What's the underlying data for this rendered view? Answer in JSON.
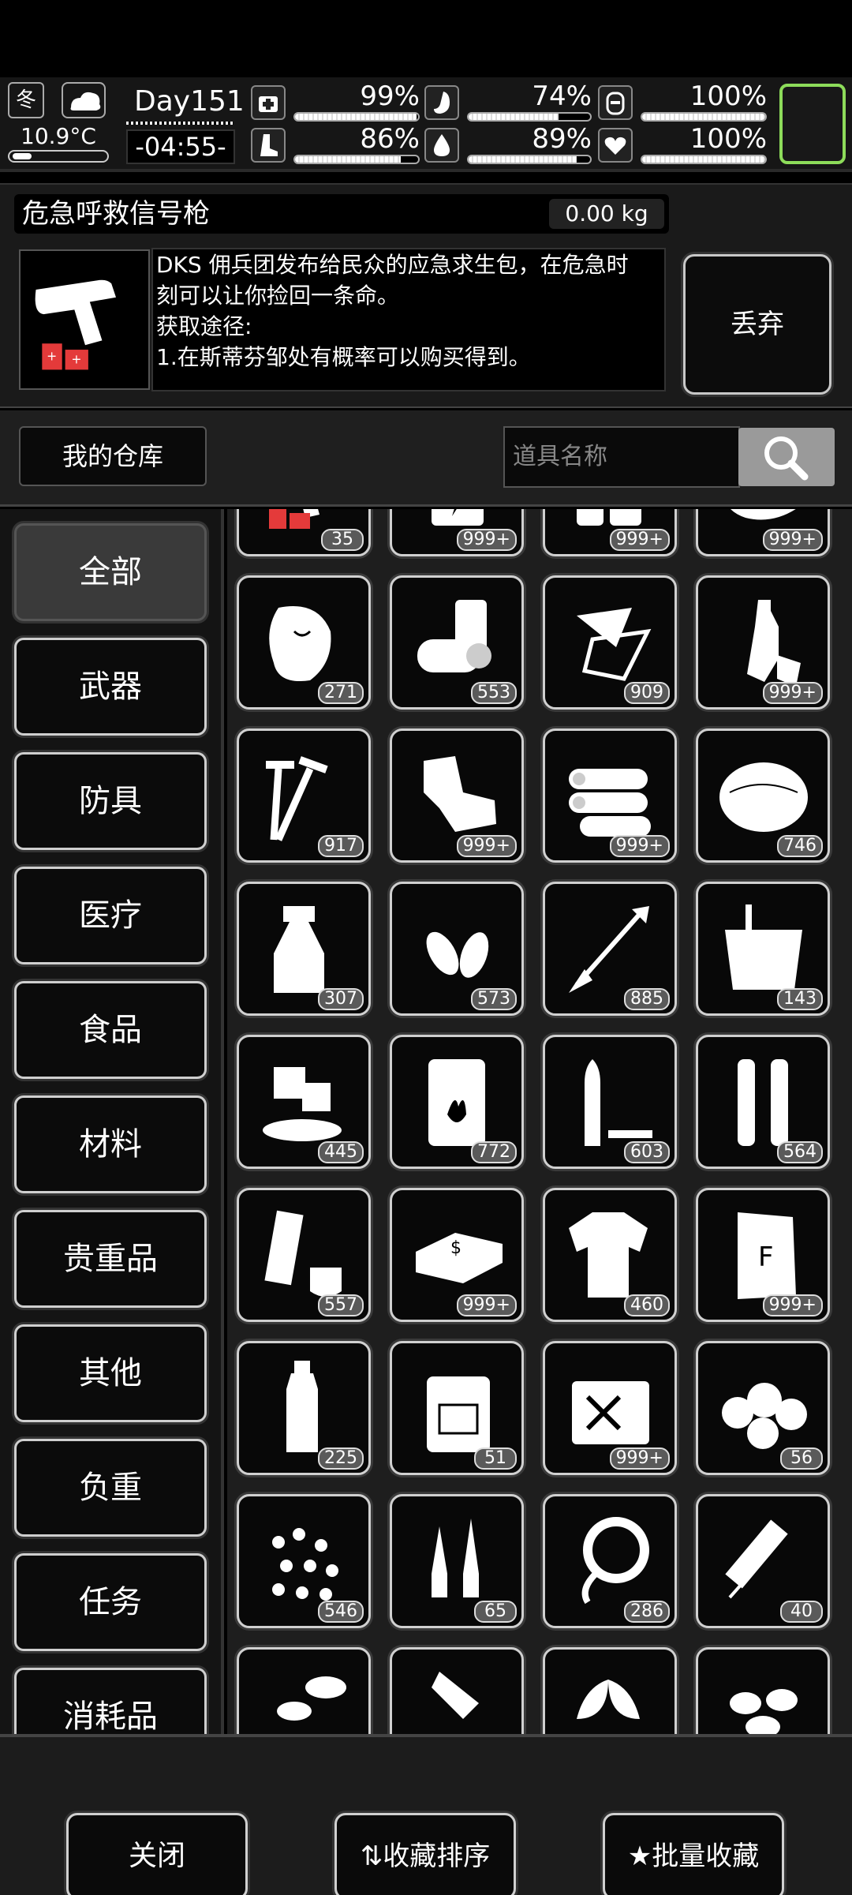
{
  "hud": {
    "season": "冬",
    "temperature": "10.9°C",
    "day": "Day151",
    "time": "-04:55-",
    "stats": [
      {
        "name": "health",
        "icon": "medkit-icon",
        "value": "99%",
        "level": 99
      },
      {
        "name": "hunger",
        "icon": "stomach-icon",
        "value": "74%",
        "level": 74
      },
      {
        "name": "armor",
        "icon": "armor-icon",
        "value": "100%",
        "level": 100
      },
      {
        "name": "stamina",
        "icon": "boot-icon",
        "value": "86%",
        "level": 86
      },
      {
        "name": "thirst",
        "icon": "water-drop-icon",
        "value": "89%",
        "level": 89
      },
      {
        "name": "mood",
        "icon": "heart-icon",
        "value": "100%",
        "level": 100
      }
    ]
  },
  "detail": {
    "item_name": "危急呼救信号枪",
    "weight": "0.00 kg",
    "desc_line1": "DKS 佣兵团发布给民众的应急求生包，在危急时",
    "desc_line2": "刻可以让你捡回一条命。",
    "desc_line3": "获取途径:",
    "desc_line4": "1.在斯蒂芬邹处有概率可以购买得到。",
    "discard_label": "丢弃"
  },
  "warehouse": {
    "title": "我的仓库",
    "search_placeholder": "道具名称"
  },
  "categories": [
    "全部",
    "武器",
    "防具",
    "医疗",
    "食品",
    "材料",
    "贵重品",
    "其他",
    "负重",
    "任务",
    "消耗品"
  ],
  "items": [
    {
      "icon": "flare-gun-icon",
      "count": "35"
    },
    {
      "icon": "battery-icon",
      "count": "999+"
    },
    {
      "icon": "cans-icon",
      "count": "999+"
    },
    {
      "icon": "cloth-icon",
      "count": "999+"
    },
    {
      "icon": "meat-icon",
      "count": "271"
    },
    {
      "icon": "tin-cans-icon",
      "count": "553"
    },
    {
      "icon": "paper-scraps-icon",
      "count": "909"
    },
    {
      "icon": "plastic-bottle-icon",
      "count": "999+"
    },
    {
      "icon": "screws-icon",
      "count": "917"
    },
    {
      "icon": "scrap-metal-icon",
      "count": "999+"
    },
    {
      "icon": "logs-icon",
      "count": "999+"
    },
    {
      "icon": "fiber-icon",
      "count": "746"
    },
    {
      "icon": "spray-bottle-icon",
      "count": "307"
    },
    {
      "icon": "bullets-icon",
      "count": "573"
    },
    {
      "icon": "arrow-icon",
      "count": "885"
    },
    {
      "icon": "bucket-icon",
      "count": "143"
    },
    {
      "icon": "ice-icon",
      "count": "445"
    },
    {
      "icon": "oil-barrel-icon",
      "count": "772"
    },
    {
      "icon": "rifle-round-icon",
      "count": "603"
    },
    {
      "icon": "shells-icon",
      "count": "564"
    },
    {
      "icon": "tube-icon",
      "count": "557"
    },
    {
      "icon": "cash-stack-icon",
      "count": "999+"
    },
    {
      "icon": "shirt-icon",
      "count": "460"
    },
    {
      "icon": "fertilizer-bag-icon",
      "count": "999+"
    },
    {
      "icon": "water-bottle-icon",
      "count": "225"
    },
    {
      "icon": "jerrycan-icon",
      "count": "51"
    },
    {
      "icon": "empty-can-icon",
      "count": "999+"
    },
    {
      "icon": "cotton-icon",
      "count": "56"
    },
    {
      "icon": "seeds-icon",
      "count": "546"
    },
    {
      "icon": "ampoules-icon",
      "count": "65"
    },
    {
      "icon": "rope-icon",
      "count": "286"
    },
    {
      "icon": "syringe-icon",
      "count": "40"
    },
    {
      "icon": "herbs-icon",
      "count": ""
    },
    {
      "icon": "vial-icon",
      "count": ""
    },
    {
      "icon": "plant-icon",
      "count": ""
    },
    {
      "icon": "shells-pile-icon",
      "count": ""
    }
  ],
  "footer": {
    "close_label": "关闭",
    "sort_label": "收藏排序",
    "batch_label": "批量收藏"
  }
}
